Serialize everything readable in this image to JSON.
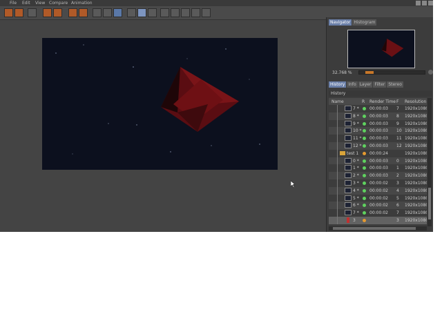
{
  "menu": [
    "File",
    "Edit",
    "View",
    "Compare",
    "Animation"
  ],
  "toolbar": {
    "buttons": [
      {
        "icon": "open-folder-icon",
        "style": "orange"
      },
      {
        "icon": "save-icon",
        "style": "orange"
      },
      {
        "icon": "film-icon",
        "style": "plain"
      },
      {
        "icon": "camera-icon",
        "style": "orange"
      },
      {
        "icon": "clapper-icon",
        "style": "orange"
      },
      {
        "icon": "render-region-icon",
        "style": "orange"
      },
      {
        "icon": "render-icon",
        "style": "orange"
      },
      {
        "icon": "stop-render-icon",
        "style": "plain"
      },
      {
        "icon": "render-settings-icon",
        "style": "plain"
      },
      {
        "icon": "render-queue-icon",
        "style": "blue"
      },
      {
        "icon": "ab-compare-icon",
        "style": "plain"
      },
      {
        "icon": "region-select-icon",
        "style": "active"
      },
      {
        "icon": "split-view-icon",
        "style": "plain"
      },
      {
        "icon": "channel-a-icon",
        "style": "plain"
      },
      {
        "icon": "channel-b-icon",
        "style": "plain"
      },
      {
        "icon": "grid-icon",
        "style": "plain"
      },
      {
        "icon": "table-icon",
        "style": "plain"
      },
      {
        "icon": "layers-icon",
        "style": "plain"
      }
    ]
  },
  "navigator": {
    "tabs": [
      "Navigator",
      "Histogram"
    ],
    "active_tab": 0,
    "zoom": "32.768 %",
    "zoom_fraction": 0.1
  },
  "history_tabs": {
    "tabs": [
      "History",
      "Info",
      "Layer",
      "Filter",
      "Stereo"
    ],
    "active_tab": 0
  },
  "history": {
    "title": "History",
    "columns": [
      "Name",
      "R",
      "Render Time",
      "F",
      "Resolution"
    ],
    "rows": [
      {
        "name": "7 *",
        "status": "green",
        "time": "00:00:03",
        "frame": "7",
        "res": "1920x1080",
        "kind": "frame"
      },
      {
        "name": "8 *",
        "status": "green",
        "time": "00:00:03",
        "frame": "8",
        "res": "1920x1080",
        "kind": "frame"
      },
      {
        "name": "9 *",
        "status": "green",
        "time": "00:00:03",
        "frame": "9",
        "res": "1920x1080",
        "kind": "frame"
      },
      {
        "name": "10 *",
        "status": "green",
        "time": "00:00:03",
        "frame": "10",
        "res": "1920x1080",
        "kind": "frame"
      },
      {
        "name": "11 *",
        "status": "green",
        "time": "00:00:03",
        "frame": "11",
        "res": "1920x1080",
        "kind": "frame"
      },
      {
        "name": "12 *",
        "status": "green",
        "time": "00:00:03",
        "frame": "12",
        "res": "1920x1080",
        "kind": "frame"
      },
      {
        "name": "test 1",
        "status": "orange",
        "time": "00:00:24",
        "frame": "",
        "res": "1920x1080",
        "kind": "folder"
      },
      {
        "name": "0 *",
        "status": "green",
        "time": "00:00:03",
        "frame": "0",
        "res": "1920x1080",
        "kind": "frame"
      },
      {
        "name": "1 *",
        "status": "green",
        "time": "00:00:03",
        "frame": "1",
        "res": "1920x1080",
        "kind": "frame"
      },
      {
        "name": "2 *",
        "status": "green",
        "time": "00:00:03",
        "frame": "2",
        "res": "1920x1080",
        "kind": "frame"
      },
      {
        "name": "3 *",
        "status": "green",
        "time": "00:00:02",
        "frame": "3",
        "res": "1920x1080",
        "kind": "frame"
      },
      {
        "name": "4 *",
        "status": "green",
        "time": "00:00:02",
        "frame": "4",
        "res": "1920x1080",
        "kind": "frame"
      },
      {
        "name": "5 *",
        "status": "green",
        "time": "00:00:02",
        "frame": "5",
        "res": "1920x1080",
        "kind": "frame"
      },
      {
        "name": "6 *",
        "status": "green",
        "time": "00:00:02",
        "frame": "6",
        "res": "1920x1080",
        "kind": "frame"
      },
      {
        "name": "7 *",
        "status": "green",
        "time": "00:00:02",
        "frame": "7",
        "res": "1920x1080",
        "kind": "frame"
      },
      {
        "name": "3",
        "status": "orange",
        "time": "",
        "frame": "3",
        "res": "1920x1080",
        "kind": "current"
      }
    ]
  },
  "colors": {
    "accent": "#6a7fa8",
    "render_bg": "#0c101e",
    "object": "#8a1a1a",
    "status_ok": "#5fd25f",
    "status_pending": "#e59a30"
  }
}
